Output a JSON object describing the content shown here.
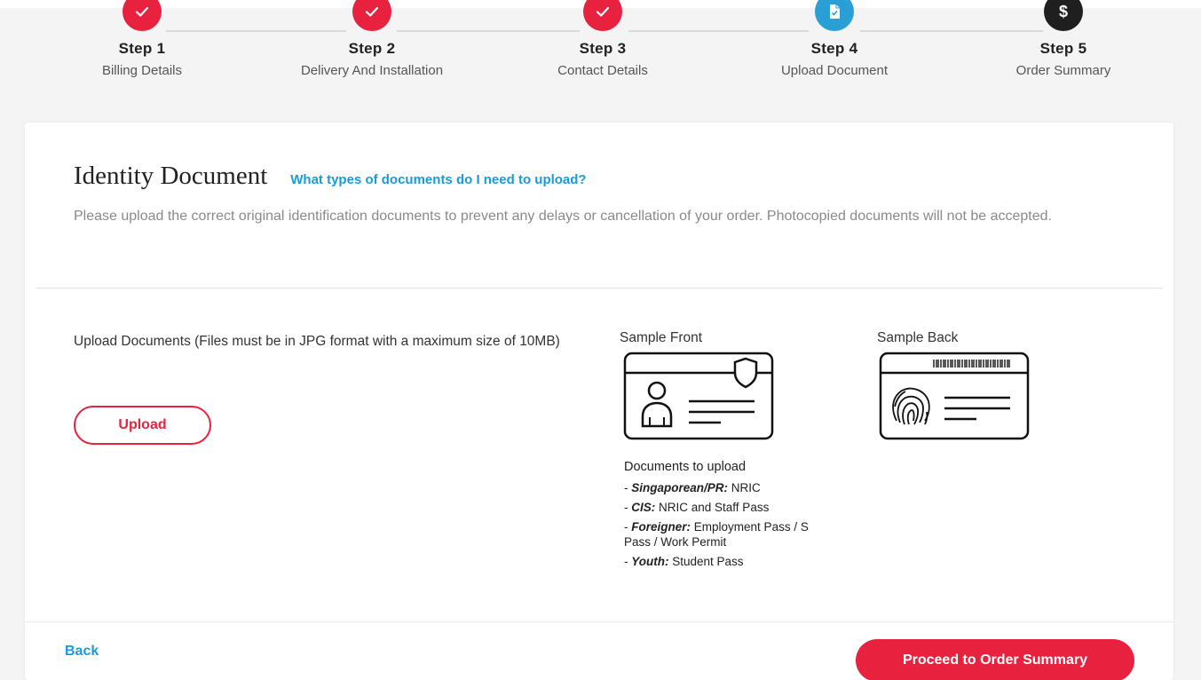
{
  "colors": {
    "accent": "#e8213f",
    "link": "#1a9ad6",
    "current_step": "#2a9fd6",
    "future_step": "#1f1f1f"
  },
  "stepper": {
    "steps": [
      {
        "number": "Step 1",
        "title": "Billing Details",
        "state": "done",
        "icon": "check-icon"
      },
      {
        "number": "Step 2",
        "title": "Delivery And Installation",
        "state": "done",
        "icon": "check-icon"
      },
      {
        "number": "Step 3",
        "title": "Contact Details",
        "state": "done",
        "icon": "check-icon"
      },
      {
        "number": "Step 4",
        "title": "Upload Document",
        "state": "current",
        "icon": "document-icon"
      },
      {
        "number": "Step 5",
        "title": "Order Summary",
        "state": "future",
        "icon": "dollar-icon",
        "symbol": "$"
      }
    ]
  },
  "section": {
    "title": "Identity Document",
    "help_link": "What types of documents do I need to upload?",
    "description": "Please upload the correct original identification documents to prevent any delays or cancellation of your order. Photocopied documents will not be accepted."
  },
  "upload": {
    "instructions": "Upload Documents (Files must be in JPG format with a maximum size of 10MB)",
    "button_label": "Upload"
  },
  "samples": {
    "front_label": "Sample Front",
    "back_label": "Sample Back",
    "documents_title": "Documents to upload",
    "documents": [
      {
        "category": "Singaporean/PR:",
        "docs": "NRIC"
      },
      {
        "category": "CIS:",
        "docs": "NRIC and Staff Pass"
      },
      {
        "category": "Foreigner:",
        "docs": "Employment Pass / S Pass / Work Permit"
      },
      {
        "category": "Youth:",
        "docs": "Student Pass"
      }
    ]
  },
  "footer": {
    "back_label": "Back",
    "proceed_label": "Proceed to Order Summary"
  }
}
